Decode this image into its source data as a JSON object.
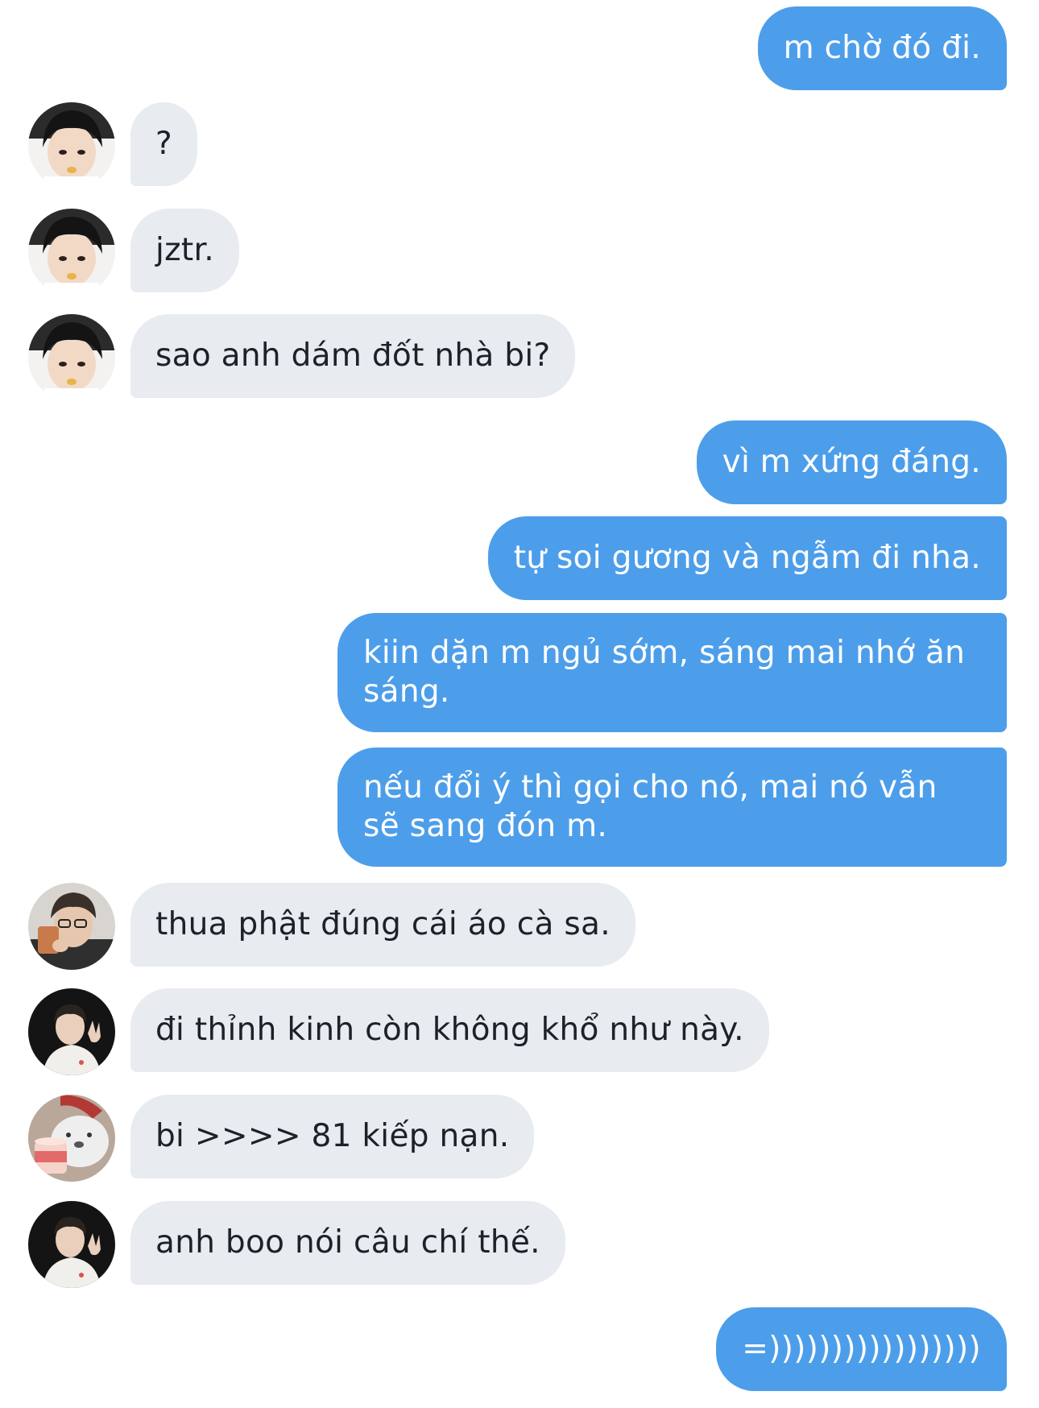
{
  "messages": [
    {
      "text": "m chờ đó đi.",
      "direction": "out"
    },
    {
      "text": "?",
      "direction": "in",
      "avatar": "avatar-boy-black-hair-icon"
    },
    {
      "text": "jztr.",
      "direction": "in",
      "avatar": "avatar-boy-black-hair-icon"
    },
    {
      "text": "sao anh dám đốt nhà bi?",
      "direction": "in",
      "avatar": "avatar-boy-black-hair-icon"
    },
    {
      "text": "vì m xứng đáng.",
      "direction": "out"
    },
    {
      "text": "tự soi gương và ngẫm đi nha.",
      "direction": "out"
    },
    {
      "text": "kiin dặn m ngủ sớm, sáng mai nhớ ăn sáng.",
      "direction": "out"
    },
    {
      "text": "nếu đổi ý thì gọi cho nó, mai nó vẫn sẽ sang đón m.",
      "direction": "out"
    },
    {
      "text": "thua phật đúng cái áo cà sa.",
      "direction": "in",
      "avatar": "avatar-boy-glasses-icon"
    },
    {
      "text": "đi thỉnh kinh còn không khổ như này.",
      "direction": "in",
      "avatar": "avatar-boy-white-shirt-icon"
    },
    {
      "text": "bi >>>> 81 kiếp nạn.",
      "direction": "in",
      "avatar": "avatar-bear-icecream-icon"
    },
    {
      "text": "anh boo nói câu chí thế.",
      "direction": "in",
      "avatar": "avatar-boy-white-shirt-icon"
    },
    {
      "text": "=)))))))))))))))))",
      "direction": "out"
    }
  ],
  "colors": {
    "outgoing_bubble": "#4d9eea",
    "incoming_bubble": "#e8ebef",
    "outgoing_text": "#ffffff",
    "incoming_text": "#1b2228"
  }
}
